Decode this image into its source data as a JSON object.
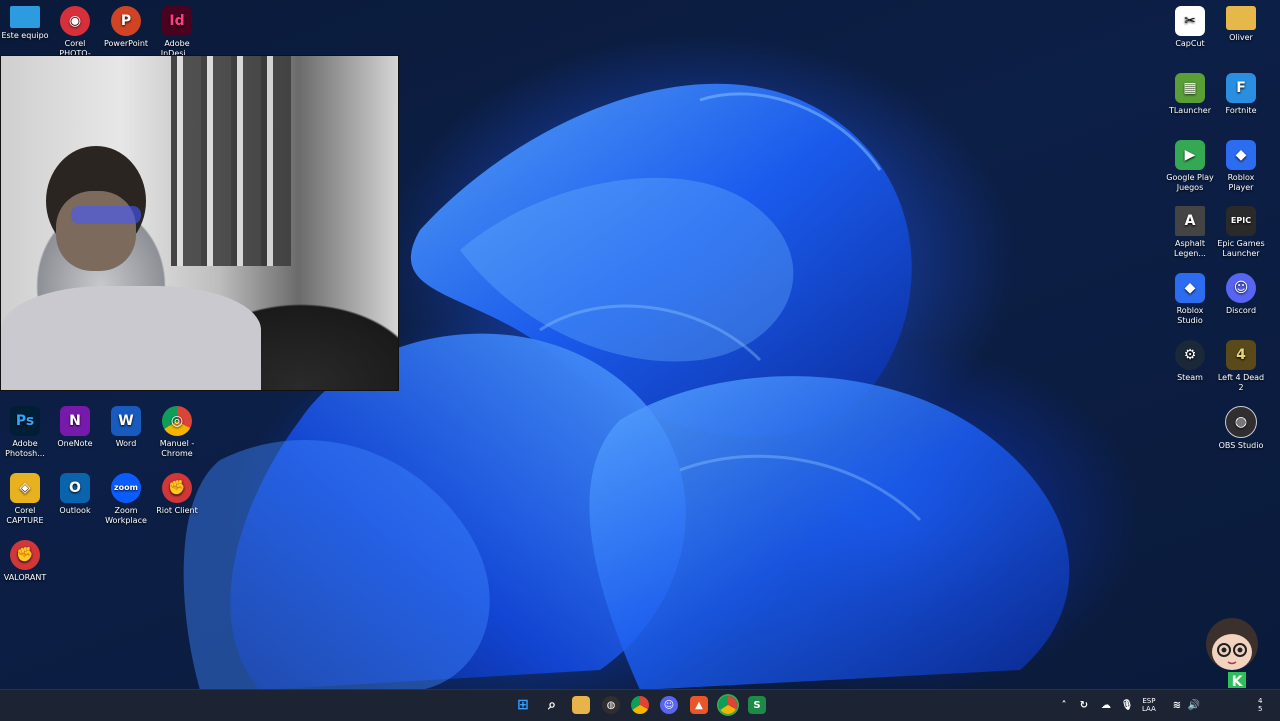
{
  "desktop": {
    "left_icons_top": [
      {
        "label": "Este equipo",
        "icon": "monitor-icon",
        "color": "#2d9be0",
        "glyph": ""
      },
      {
        "label": "Corel PHOTO-PAI...",
        "icon": "corel-photo-paint-icon",
        "color": "#d8303a",
        "glyph": "◉"
      },
      {
        "label": "PowerPoint",
        "icon": "powerpoint-icon",
        "color": "#d04423",
        "glyph": "P"
      },
      {
        "label": "Adobe InDesi...",
        "icon": "indesign-icon",
        "color": "#49021f",
        "glyph": "Id"
      }
    ],
    "left_icons_grid": [
      {
        "label": "Adobe Photosh...",
        "icon": "photoshop-icon",
        "color": "#001e36",
        "glyph": "Ps"
      },
      {
        "label": "OneNote",
        "icon": "onenote-icon",
        "color": "#7719aa",
        "glyph": "N"
      },
      {
        "label": "Word",
        "icon": "word-icon",
        "color": "#185abd",
        "glyph": "W"
      },
      {
        "label": "Manuel - Chrome",
        "icon": "chrome-icon",
        "color": "#db4437",
        "glyph": "◎"
      },
      {
        "label": "Corel CAPTURE",
        "icon": "corel-capture-icon",
        "color": "#e8b120",
        "glyph": "◈"
      },
      {
        "label": "Outlook",
        "icon": "outlook-icon",
        "color": "#0a64ad",
        "glyph": "O"
      },
      {
        "label": "Zoom Workplace",
        "icon": "zoom-icon",
        "color": "#0b5cff",
        "glyph": "zoom"
      },
      {
        "label": "Riot Client",
        "icon": "riot-client-icon",
        "color": "#d13639",
        "glyph": "✊"
      },
      {
        "label": "VALORANT",
        "icon": "valorant-icon",
        "color": "#d13639",
        "glyph": "✊"
      }
    ],
    "right_icons": [
      {
        "label": "CapCut",
        "icon": "capcut-icon",
        "color": "#ffffff",
        "glyph": "✂"
      },
      {
        "label": "Oliver",
        "icon": "folder-icon",
        "color": "#e6b84a",
        "glyph": ""
      },
      {
        "label": "TLauncher",
        "icon": "tlauncher-icon",
        "color": "#5a9e36",
        "glyph": "▦"
      },
      {
        "label": "Fortnite",
        "icon": "fortnite-icon",
        "color": "#2a8fe0",
        "glyph": "F"
      },
      {
        "label": "Google Play Juegos",
        "icon": "google-play-games-icon",
        "color": "#34a853",
        "glyph": "▶"
      },
      {
        "label": "Roblox Player",
        "icon": "roblox-player-icon",
        "color": "#2b6cf0",
        "glyph": "◆"
      },
      {
        "label": "Asphalt Legen...",
        "icon": "asphalt-icon",
        "color": "#444444",
        "glyph": "A"
      },
      {
        "label": "Epic Games Launcher",
        "icon": "epic-games-icon",
        "color": "#2a2a2a",
        "glyph": "EPIC"
      },
      {
        "label": "Roblox Studio",
        "icon": "roblox-studio-icon",
        "color": "#2b6cf0",
        "glyph": "◆"
      },
      {
        "label": "Discord",
        "icon": "discord-icon",
        "color": "#5865f2",
        "glyph": "☺"
      },
      {
        "label": "Steam",
        "icon": "steam-icon",
        "color": "#1b2838",
        "glyph": "⚙"
      },
      {
        "label": "Left 4 Dead 2",
        "icon": "left4dead2-icon",
        "color": "#5a4a1a",
        "glyph": "4"
      },
      {
        "label": "OBS Studio",
        "icon": "obs-studio-icon",
        "color": "#302e31",
        "glyph": "◍"
      }
    ]
  },
  "taskbar": {
    "items": [
      {
        "icon": "start-icon",
        "color": "#3aa0ff",
        "glyph": "⊞"
      },
      {
        "icon": "search-icon",
        "color": "#1c2333",
        "glyph": "⌕"
      },
      {
        "icon": "file-explorer-icon",
        "color": "#e8b34a",
        "glyph": "▬"
      },
      {
        "icon": "obs-studio-icon",
        "color": "#302e31",
        "glyph": "◍"
      },
      {
        "icon": "chrome-icon",
        "color": "#db4437",
        "glyph": "◎"
      },
      {
        "icon": "discord-icon",
        "color": "#5865f2",
        "glyph": "☺"
      },
      {
        "icon": "app-orange-icon",
        "color": "#e8562a",
        "glyph": "▲"
      },
      {
        "icon": "chrome-profile-icon",
        "color": "#34a853",
        "glyph": "◎"
      },
      {
        "icon": "app-green-icon",
        "color": "#1e8a4a",
        "glyph": "S"
      }
    ],
    "tray": {
      "language_top": "ESP",
      "language_bottom": "LAA",
      "clock_top": "4",
      "clock_bottom": "5"
    }
  }
}
